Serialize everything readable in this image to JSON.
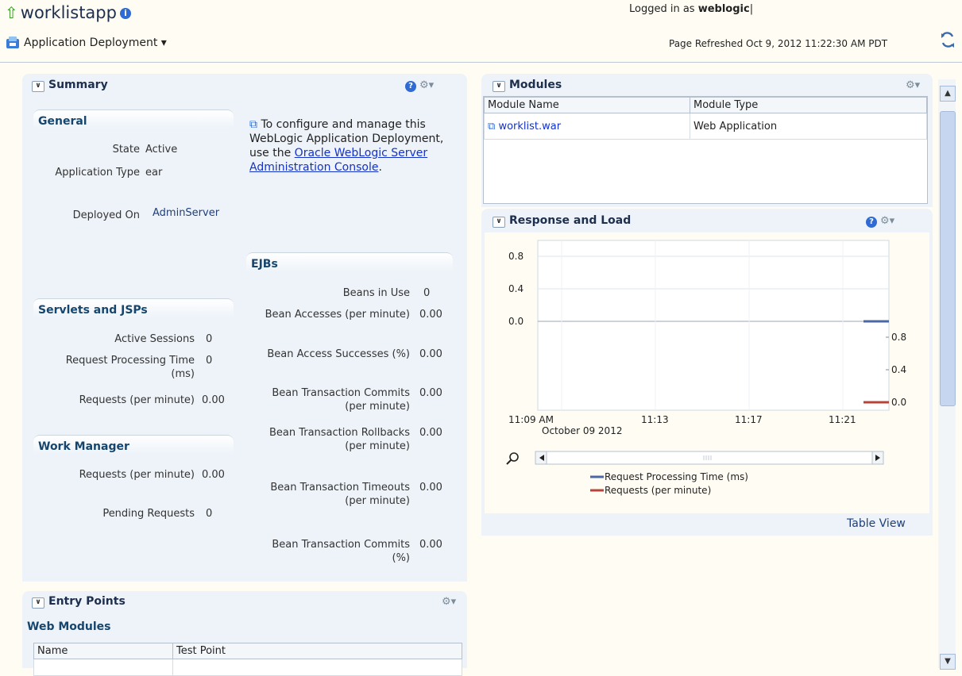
{
  "header": {
    "app_name": "worklistapp",
    "info_glyph": "i",
    "menu_label": "Application Deployment ▾",
    "logged_in_prefix": "Logged in as",
    "logged_in_user": "weblogic",
    "logged_in_separator": "|",
    "refreshed": "Page Refreshed Oct 9, 2012 11:22:30 AM PDT"
  },
  "summary": {
    "title": "Summary",
    "general": {
      "title": "General",
      "rows": [
        {
          "label": "State",
          "value": "Active"
        },
        {
          "label": "Application Type",
          "value": "ear"
        },
        {
          "label": "Deployed On",
          "value": "AdminServer"
        }
      ]
    },
    "note": {
      "pre": "To configure and manage this WebLogic Application Deployment, use the",
      "link": "Oracle WebLogic Server Administration Console",
      "post": "."
    },
    "servlets": {
      "title": "Servlets and JSPs",
      "rows": [
        {
          "label": "Active Sessions",
          "value": "0"
        },
        {
          "label": "Request Processing Time (ms)",
          "value": "0"
        },
        {
          "label": "Requests (per minute)",
          "value": "0.00"
        }
      ]
    },
    "work_manager": {
      "title": "Work Manager",
      "rows": [
        {
          "label": "Requests (per minute)",
          "value": "0.00"
        },
        {
          "label": "Pending Requests",
          "value": "0"
        }
      ]
    },
    "ejbs": {
      "title": "EJBs",
      "rows": [
        {
          "label": "Beans in Use",
          "value": "0"
        },
        {
          "label": "Bean Accesses (per minute)",
          "value": "0.00"
        },
        {
          "label": "Bean Access Successes (%)",
          "value": "0.00"
        },
        {
          "label": "Bean Transaction Commits (per minute)",
          "value": "0.00"
        },
        {
          "label": "Bean Transaction Rollbacks (per minute)",
          "value": "0.00"
        },
        {
          "label": "Bean Transaction Timeouts (per minute)",
          "value": "0.00"
        },
        {
          "label": "Bean Transaction Commits (%)",
          "value": "0.00"
        }
      ]
    }
  },
  "entry_points": {
    "title": "Entry Points",
    "web_modules_title": "Web Modules",
    "columns": [
      "Name",
      "Test Point"
    ]
  },
  "modules": {
    "title": "Modules",
    "columns": [
      "Module Name",
      "Module Type"
    ],
    "rows": [
      {
        "name": "worklist.war",
        "type": "Web Application"
      }
    ]
  },
  "response": {
    "title": "Response and Load",
    "table_view": "Table View"
  },
  "colors": {
    "series_processing": "#4a68a6",
    "series_requests": "#b8433a",
    "panel_bg": "#edf3f9"
  },
  "chart_data": {
    "type": "line",
    "title": "",
    "x_ticks": [
      "11:09 AM",
      "11:13",
      "11:17",
      "11:21"
    ],
    "x_date": "October 09 2012",
    "left_axis": {
      "ticks": [
        "0.8",
        "0.4",
        "0.0"
      ],
      "ylim": [
        0.0,
        0.8
      ]
    },
    "right_axis": {
      "ticks": [
        "0.8",
        "0.4",
        "0.0"
      ],
      "ylim": [
        0.0,
        0.8
      ]
    },
    "grid": true,
    "legend_position": "bottom",
    "series": [
      {
        "name": "Request Processing Time (ms)",
        "axis": "left",
        "values": [
          0.0
        ]
      },
      {
        "name": "Requests (per minute)",
        "axis": "right",
        "values": [
          0.0
        ]
      }
    ]
  }
}
